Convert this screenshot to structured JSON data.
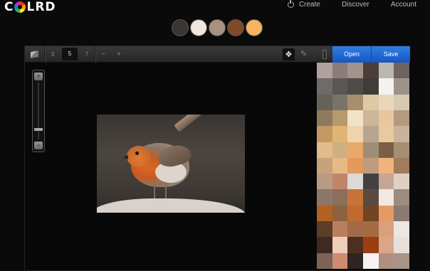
{
  "brand": {
    "logo_left": "C",
    "logo_right": "LRD"
  },
  "nav": {
    "create": "Create",
    "discover": "Discover",
    "account": "Account"
  },
  "palette": [
    "#3a3632",
    "#f2e6dc",
    "#a8917f",
    "#7e4a2a",
    "#f5b55f"
  ],
  "toolbar": {
    "sizes": [
      "3",
      "5",
      "7"
    ],
    "active_size": "5",
    "minus": "−",
    "plus": "+",
    "open_label": "Open",
    "save_label": "Save"
  },
  "zoom": {
    "plus": "+",
    "minus": "−",
    "level": 0.82
  },
  "mosaic_colors": [
    "#b0a09f",
    "#8d7b7b",
    "#a4928c",
    "#4a3d3b",
    "#bdb7b3",
    "#6f6260",
    "#6e6b69",
    "#5a5654",
    "#4d4b48",
    "#3f3c39",
    "#f4f2ee",
    "#9c9489",
    "#65625a",
    "#7a7468",
    "#a88e6d",
    "#dfc9a4",
    "#e9d7bd",
    "#d7c9b2",
    "#8f7a5f",
    "#b79a6a",
    "#f0e2c8",
    "#ccb69a",
    "#eac69f",
    "#b39b7e",
    "#c59862",
    "#e0b572",
    "#eed4ae",
    "#b8a591",
    "#e8c9a0",
    "#c8b39b",
    "#e2bb8c",
    "#cfaf82",
    "#e8a968",
    "#a08d75",
    "#7a5e45",
    "#a68d73",
    "#c9a27d",
    "#e7b983",
    "#e39a5b",
    "#c09c7f",
    "#f1b37b",
    "#a37b5c",
    "#b89b85",
    "#c0866c",
    "#dcdad8",
    "#434041",
    "#c6a593",
    "#dfd0c5",
    "#8b7767",
    "#8d6d5c",
    "#c8733a",
    "#5c4a40",
    "#f1e8e2",
    "#9c8b80",
    "#b46020",
    "#8c6240",
    "#c06a32",
    "#6f4523",
    "#e59a62",
    "#8b7a70",
    "#5c3d28",
    "#b97f5d",
    "#a26a48",
    "#a36b44",
    "#d9a07e",
    "#eee6e0",
    "#3e2a22",
    "#f0cdb8",
    "#4e2e1e",
    "#9c3e12",
    "#d9a688",
    "#e7e0da",
    "#7c6356",
    "#cd8c70",
    "#2e2420",
    "#f6f4f2",
    "#b08f80",
    "#a89388"
  ]
}
